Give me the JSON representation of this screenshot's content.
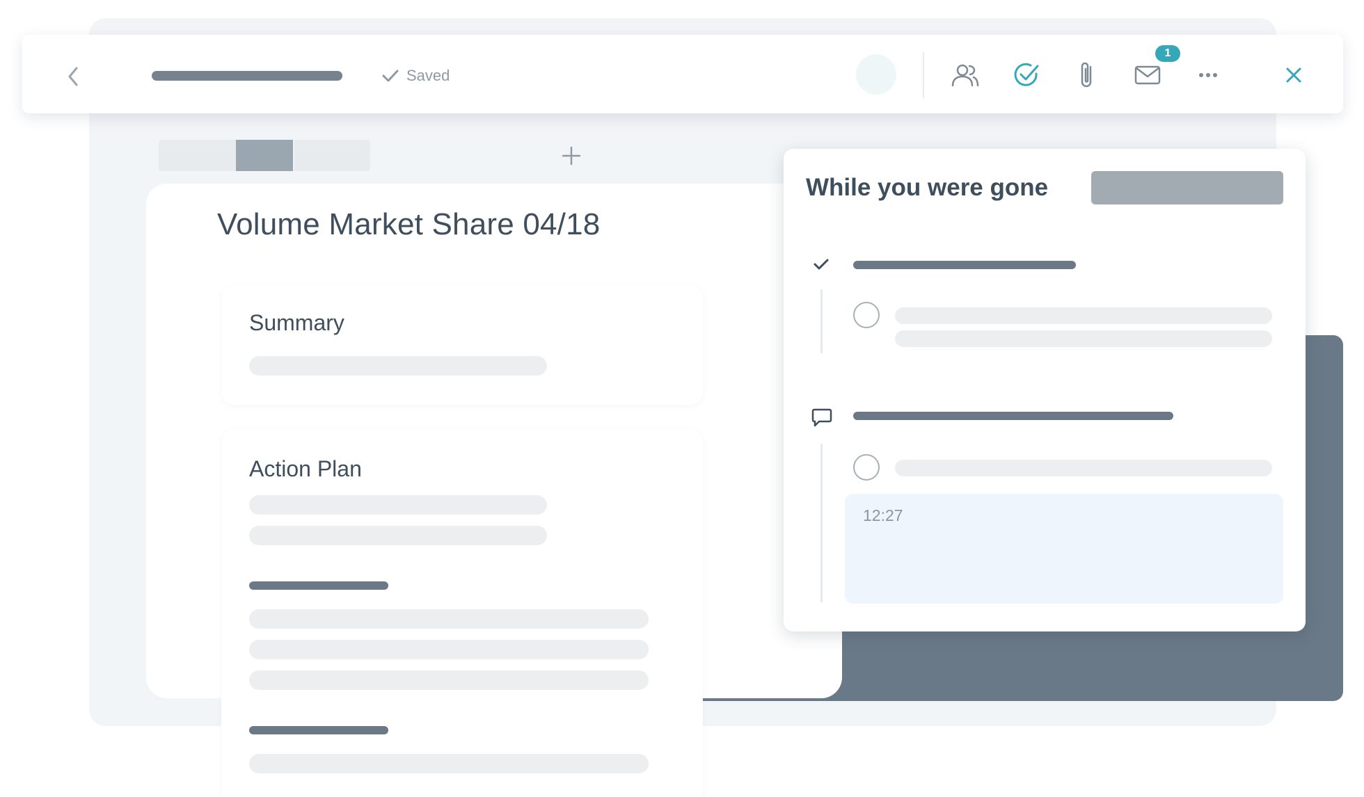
{
  "toolbar": {
    "saved_label": "Saved",
    "notification_count": "1",
    "icons": [
      "chevron-left-icon",
      "check-icon",
      "people-icon",
      "check-circle-icon",
      "paperclip-icon",
      "mail-icon",
      "more-icon",
      "close-icon"
    ],
    "accent_color": "#35a7b8"
  },
  "document": {
    "title": "Volume Market Share 04/18",
    "summary_title": "Summary",
    "action_plan_title": "Action Plan"
  },
  "popup": {
    "title": "While you were gone",
    "message_time": "12:27"
  },
  "colors": {
    "text_primary": "#3f4e5c",
    "placeholder": "#eceef0",
    "dark_panel": "#6a7987"
  }
}
